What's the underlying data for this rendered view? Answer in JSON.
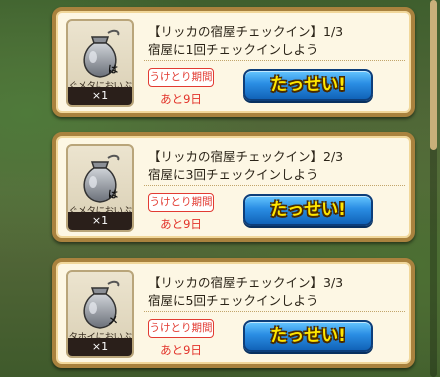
{
  "missions": [
    {
      "title": "【リッカの宿屋チェックイン】1/3",
      "description": "宿屋に1回チェックインしよう",
      "reward": {
        "icon": "silver-pouch-icon",
        "tag": "は",
        "name": "ぐメタにおいぶくろ",
        "count": "×1"
      },
      "period_label": "うけとり期間",
      "period_value": "あと9日",
      "button_label": "たっせい!"
    },
    {
      "title": "【リッカの宿屋チェックイン】2/3",
      "description": "宿屋に3回チェックインしよう",
      "reward": {
        "icon": "silver-pouch-icon",
        "tag": "は",
        "name": "ぐメタにおいぶくろ",
        "count": "×1"
      },
      "period_label": "うけとり期間",
      "period_value": "あと9日",
      "button_label": "たっせい!"
    },
    {
      "title": "【リッカの宿屋チェックイン】3/3",
      "description": "宿屋に5回チェックインしよう",
      "reward": {
        "icon": "silver-pouch-icon",
        "tag": "メ",
        "name": "タホイにおいぶくろ",
        "count": "×1"
      },
      "period_label": "うけとり期間",
      "period_value": "あと9日",
      "button_label": "たっせい!"
    }
  ],
  "colors": {
    "frame": "#a9823e",
    "card": "#fdf7e4",
    "period_red": "#e2332a",
    "button_blue": "#2a8de3",
    "button_text": "#ffe600"
  }
}
